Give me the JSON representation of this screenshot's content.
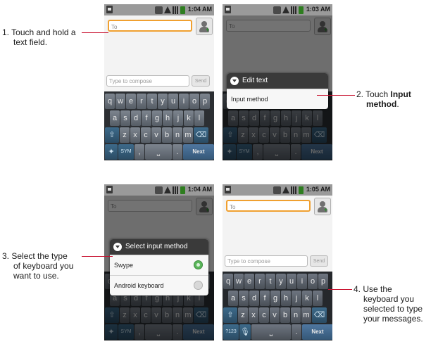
{
  "callouts": {
    "c1": {
      "number": "1.",
      "line1": "Touch and hold a",
      "line2": "text field."
    },
    "c2": {
      "number": "2.",
      "pre": "Touch ",
      "bold1": "Input",
      "bold2": "method",
      "post": "."
    },
    "c3": {
      "number": "3.",
      "line1": "Select the type",
      "line2": "of keyboard you",
      "line3": "want to use."
    },
    "c4": {
      "number": "4.",
      "line1": "Use the",
      "line2": "keyboard you",
      "line3": "selected to type",
      "line4": "your messages."
    }
  },
  "phones": {
    "p1": {
      "time": "1:04 AM",
      "to": "To",
      "compose": "Type to compose",
      "send": "Send"
    },
    "p2": {
      "time": "1:03 AM",
      "to": "To",
      "dialog_title": "Edit text",
      "dialog_item": "Input method"
    },
    "p3": {
      "time": "1:04 AM",
      "to": "To",
      "dialog_title": "Select input method",
      "option1": "Swype",
      "option2": "Android keyboard"
    },
    "p4": {
      "time": "1:05 AM",
      "to": "To",
      "compose": "Type to compose",
      "send": "Send"
    }
  },
  "keyboard": {
    "row1": [
      "q",
      "w",
      "e",
      "r",
      "t",
      "y",
      "u",
      "i",
      "o",
      "p"
    ],
    "row2": [
      "a",
      "s",
      "d",
      "f",
      "g",
      "h",
      "j",
      "k",
      "l"
    ],
    "row3": [
      "z",
      "x",
      "c",
      "v",
      "b",
      "n",
      "m"
    ],
    "sym": "SYM",
    "next": "Next",
    "num": "?123"
  },
  "icons": {
    "statusbar": [
      "sd-card-icon",
      "usb-icon",
      "warning-icon",
      "signal-icon",
      "battery-icon"
    ],
    "contact": "add-contact-icon",
    "dialog": "dialog-menu-icon",
    "swype": "swype-icon",
    "mic": "microphone-icon",
    "shift": "shift-icon",
    "delete": "delete-icon"
  },
  "colors": {
    "leader": "#c8102e",
    "focus": "#f0a030",
    "radio_on": "#5ab65a",
    "key": "#5a616a"
  }
}
